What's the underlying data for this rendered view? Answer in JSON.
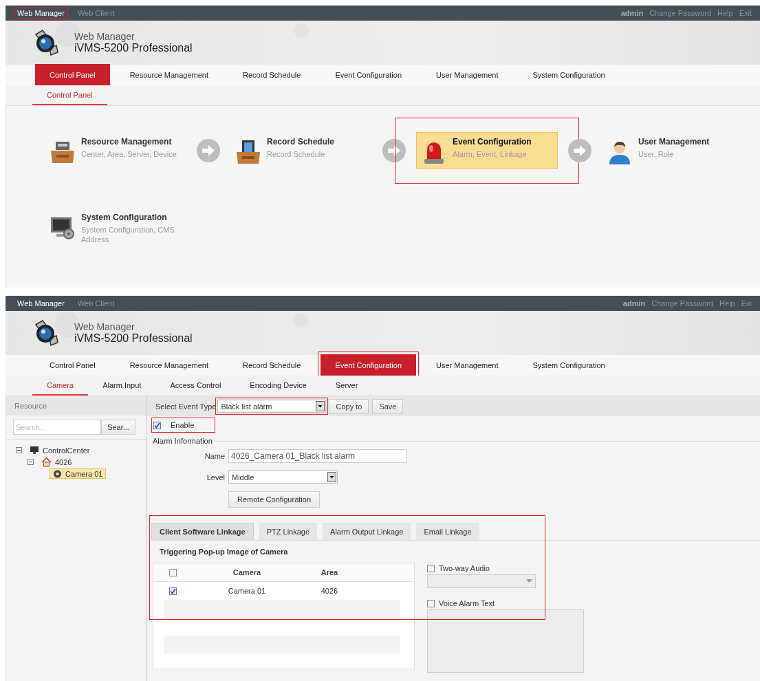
{
  "control_panel_screen": {
    "top_bar": {
      "apps": [
        {
          "label": "Web Manager",
          "selected": true,
          "annotated": true
        },
        {
          "label": "Web Client",
          "selected": false,
          "annotated": false
        }
      ],
      "user": "admin",
      "links": [
        "Change Password",
        "Help",
        "Exit"
      ]
    },
    "header": {
      "subtitle": "Web Manager",
      "title": "iVMS-5200 Professional"
    },
    "nav": [
      {
        "label": "Control Panel",
        "selected": true,
        "annotated": false
      },
      {
        "label": "Resource Management",
        "selected": false,
        "annotated": false
      },
      {
        "label": "Record Schedule",
        "selected": false,
        "annotated": false
      },
      {
        "label": "Event Configuration",
        "selected": false,
        "annotated": false
      },
      {
        "label": "User Management",
        "selected": false,
        "annotated": false
      },
      {
        "label": "System Configuration",
        "selected": false,
        "annotated": false
      }
    ],
    "subnav": [
      {
        "label": "Control Panel",
        "selected": true
      }
    ],
    "module_rows": [
      [
        {
          "kind": "resource",
          "title": "Resource Management",
          "description": "Center, Area, Server, Device",
          "selected": false,
          "annotated": false
        },
        {
          "kind": "schedule",
          "title": "Record Schedule",
          "description": "Record Schedule",
          "selected": false,
          "annotated": false
        },
        {
          "kind": "event",
          "title": "Event Configuration",
          "description": "Alarm, Event, Linkage",
          "selected": true,
          "annotated": true
        },
        {
          "kind": "user",
          "title": "User Management",
          "description": "User, Role",
          "selected": false,
          "annotated": false
        }
      ],
      [
        {
          "kind": "system",
          "title": "System Configuration",
          "description": "System Configuration, CMS Address",
          "selected": false,
          "annotated": false
        }
      ]
    ]
  },
  "event_configuration_screen": {
    "top_bar": {
      "apps": [
        {
          "label": "Web Manager",
          "selected": true,
          "annotated": false
        },
        {
          "label": "Web Client",
          "selected": false,
          "annotated": false
        }
      ],
      "user": "admin",
      "links": [
        "Change Password",
        "Help",
        "Exi"
      ]
    },
    "header": {
      "subtitle": "Web Manager",
      "title": "iVMS-5200 Professional"
    },
    "nav": [
      {
        "label": "Control Panel",
        "selected": false,
        "annotated": false
      },
      {
        "label": "Resource Management",
        "selected": false,
        "annotated": false
      },
      {
        "label": "Record Schedule",
        "selected": false,
        "annotated": false
      },
      {
        "label": "Event Configuration",
        "selected": true,
        "annotated": true
      },
      {
        "label": "User Management",
        "selected": false,
        "annotated": false
      },
      {
        "label": "System Configuration",
        "selected": false,
        "annotated": false
      }
    ],
    "subnav": [
      {
        "label": "Camera",
        "selected": true
      },
      {
        "label": "Alarm Input",
        "selected": false
      },
      {
        "label": "Access Control",
        "selected": false
      },
      {
        "label": "Encoding Device",
        "selected": false
      },
      {
        "label": "Server",
        "selected": false
      }
    ],
    "sidebar": {
      "title": "Resource",
      "search": {
        "placeholder": "Search...",
        "button": "Sear..."
      },
      "tree": [
        {
          "kind": "center",
          "label": "ControlCenter",
          "expanded": true,
          "selected": false,
          "children": [
            {
              "kind": "area",
              "label": "4026",
              "expanded": true,
              "selected": false,
              "children": [
                {
                  "kind": "camera",
                  "label": "Camera 01",
                  "selected": true
                }
              ]
            }
          ]
        }
      ]
    },
    "toolbar": {
      "label": "Select Event Type",
      "event_type": {
        "value": "Black list alarm",
        "annotated": true
      },
      "buttons": [
        "Copy to",
        "Save"
      ]
    },
    "enable": {
      "label": "Enable",
      "checked": true,
      "annotated": true
    },
    "alarm_information": {
      "title": "Alarm Information",
      "name_label": "Name",
      "name": "4026_Camera 01_Black list alarm",
      "level_label": "Level",
      "level": "Middle",
      "button": "Remote Configuration"
    },
    "linkage": {
      "annotated": true,
      "tabs": [
        {
          "label": "Client Software Linkage",
          "selected": true
        },
        {
          "label": "PTZ Linkage",
          "selected": false
        },
        {
          "label": "Alarm Output Linkage",
          "selected": false
        },
        {
          "label": "Email Linkage",
          "selected": false
        }
      ],
      "heading": "Triggering Pop-up Image of Camera",
      "table": {
        "checked": false,
        "columns": [
          "Camera",
          "Area"
        ],
        "rows": [
          {
            "checked": true,
            "camera": "Camera 01",
            "area": "4026"
          }
        ]
      },
      "options": [
        {
          "kind": "dropdown",
          "label": "Two-way Audio",
          "checked": false
        },
        {
          "kind": "text",
          "label": "Voice Alarm Text",
          "checked": false
        }
      ]
    }
  }
}
